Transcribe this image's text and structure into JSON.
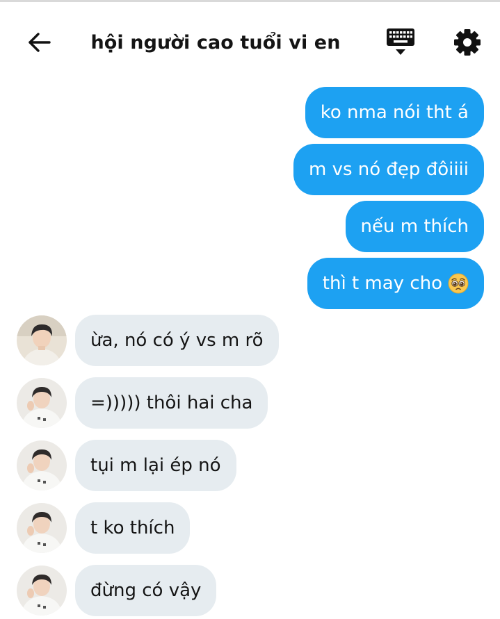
{
  "header": {
    "title": "hội người cao tuổi vi en",
    "back_icon": "arrow-left-icon",
    "keyboard_icon": "keyboard-icon",
    "settings_icon": "gear-icon"
  },
  "colors": {
    "outgoing_bubble": "#1da1f2",
    "incoming_bubble": "#e6ecf0",
    "text_dark": "#141414"
  },
  "messages": {
    "outgoing": [
      {
        "text": "ko nma nói tht á"
      },
      {
        "text": "m vs nó đẹp đôiiii"
      },
      {
        "text": "nếu m thích"
      },
      {
        "text": "thì t may cho",
        "emoji": "pleading-face-emoji"
      }
    ],
    "incoming": [
      {
        "text": "ừa, nó có ý vs m rõ",
        "avatar": "avatar-user-a"
      },
      {
        "text": "=))))) thôi hai cha",
        "avatar": "avatar-user-b"
      },
      {
        "text": "tụi m lại ép nó",
        "avatar": "avatar-user-b"
      },
      {
        "text": "t ko thích",
        "avatar": "avatar-user-b"
      },
      {
        "text": "đừng có vậy",
        "avatar": "avatar-user-b"
      }
    ]
  }
}
